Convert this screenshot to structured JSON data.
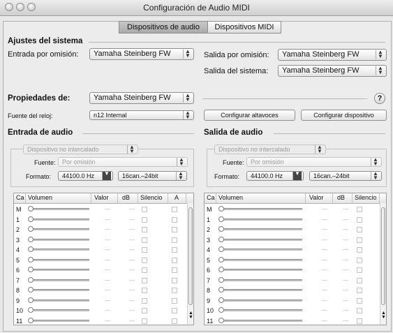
{
  "window": {
    "title": "Configuración de Audio MIDI"
  },
  "tabs": [
    {
      "label": "Dispositivos de audio",
      "active": true
    },
    {
      "label": "Dispositivos MIDI",
      "active": false
    }
  ],
  "system": {
    "heading": "Ajustes del sistema",
    "default_input_label": "Entrada por omisión:",
    "default_input_value": "Yamaha Steinberg FW",
    "default_output_label": "Salida por omisión:",
    "default_output_value": "Yamaha Steinberg FW",
    "system_output_label": "Salida del sistema:",
    "system_output_value": "Yamaha Steinberg FW"
  },
  "properties": {
    "label": "Propiedades de:",
    "device_value": "Yamaha Steinberg FW",
    "help": "?",
    "clock_label": "Fuente del reloj:",
    "clock_value": "n12 Internal",
    "configure_speakers": "Configurar altavoces",
    "configure_device": "Configurar dispositivo"
  },
  "input": {
    "heading": "Entrada de audio",
    "device_mode": "Dispositivo no intercalado",
    "source_label": "Fuente:",
    "source_value": "Por omisión",
    "format_label": "Formato:",
    "format_rate": "44100.0 Hz",
    "format_bits": "16can.–24bit",
    "columns": [
      "Ca",
      "Volumen",
      "Valor",
      "dB",
      "Silencio",
      "A"
    ],
    "channels": [
      "M",
      "1",
      "2",
      "3",
      "4",
      "5",
      "6",
      "7",
      "8",
      "9",
      "10",
      "11"
    ]
  },
  "output": {
    "heading": "Salida de audio",
    "device_mode": "Dispositivo no intercalado",
    "source_label": "Fuente:",
    "source_value": "Por omisión",
    "format_label": "Formato:",
    "format_rate": "44100.0 Hz",
    "format_bits": "16can.–24bit",
    "columns": [
      "Ca",
      "Volumen",
      "Valor",
      "dB",
      "Silencio"
    ],
    "channels": [
      "M",
      "1",
      "2",
      "3",
      "4",
      "5",
      "6",
      "7",
      "8",
      "9",
      "10",
      "11"
    ]
  },
  "cell_placeholder": "—",
  "icons": [
    "close-light-icon",
    "minimize-light-icon",
    "zoom-light-icon",
    "popup-arrows-icon",
    "slider-knob-icon",
    "help-icon"
  ]
}
